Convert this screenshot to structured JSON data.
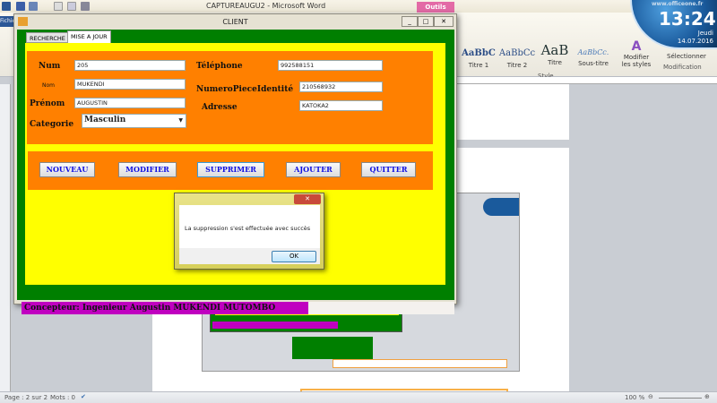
{
  "word": {
    "title": "CAPTUREAUGU2 - Microsoft Word",
    "contextual_tab": "Outils Image",
    "file_tab": "Fichier",
    "styles": [
      {
        "preview": "AaBbC",
        "label": "Titre 1"
      },
      {
        "preview": "AaBbCc",
        "label": "Titre 2"
      },
      {
        "preview": "AaB",
        "label": "Titre"
      },
      {
        "preview": "AaBbCc.",
        "label": "Sous-titre"
      }
    ],
    "modify_styles": "Modifier les styles",
    "style_group": "Style",
    "modification_group": "Modification",
    "select_label": "Sélectionner",
    "status": {
      "page": "Page : 2 sur 2",
      "words": "Mots : 0",
      "zoom": "100 %"
    }
  },
  "clock": {
    "site": "www.officeone.fr",
    "time": "13:24",
    "day": "Jeudi",
    "date": "14.07.2016"
  },
  "window": {
    "title": "CLIENT",
    "tabs": [
      {
        "label": "RECHERCHE",
        "active": false
      },
      {
        "label": "MISE A JOUR",
        "active": true
      }
    ]
  },
  "form": {
    "num": {
      "label": "Num",
      "value": "205"
    },
    "nom": {
      "label": "Nom",
      "value": "MUKENDI"
    },
    "prenom": {
      "label": "Prénom",
      "value": "AUGUSTIN"
    },
    "categorie": {
      "label": "Categorie",
      "value": "Masculin"
    },
    "telephone": {
      "label": "Téléphone",
      "value": "992588151"
    },
    "piece": {
      "label": "NumeroPieceIdentité",
      "value": "210568932"
    },
    "adresse": {
      "label": "Adresse",
      "value": "KATOKA2"
    }
  },
  "buttons": {
    "nouveau": "NOUVEAU",
    "modifier": "MODIFIER",
    "supprimer": "SUPPRIMER",
    "ajouter": "AJOUTER",
    "quitter": "QUITTER"
  },
  "footer": "Concepteur: Ingenieur  Augustin MUKENDI  MUTOMBO",
  "dialog": {
    "message": "La suppression s'est effectuée avec succès",
    "ok": "OK"
  },
  "colors": {
    "green": "#007f00",
    "yellow": "#ffff00",
    "orange": "#ff8000",
    "purple": "#c000c0",
    "button_text": "#1010e0"
  }
}
